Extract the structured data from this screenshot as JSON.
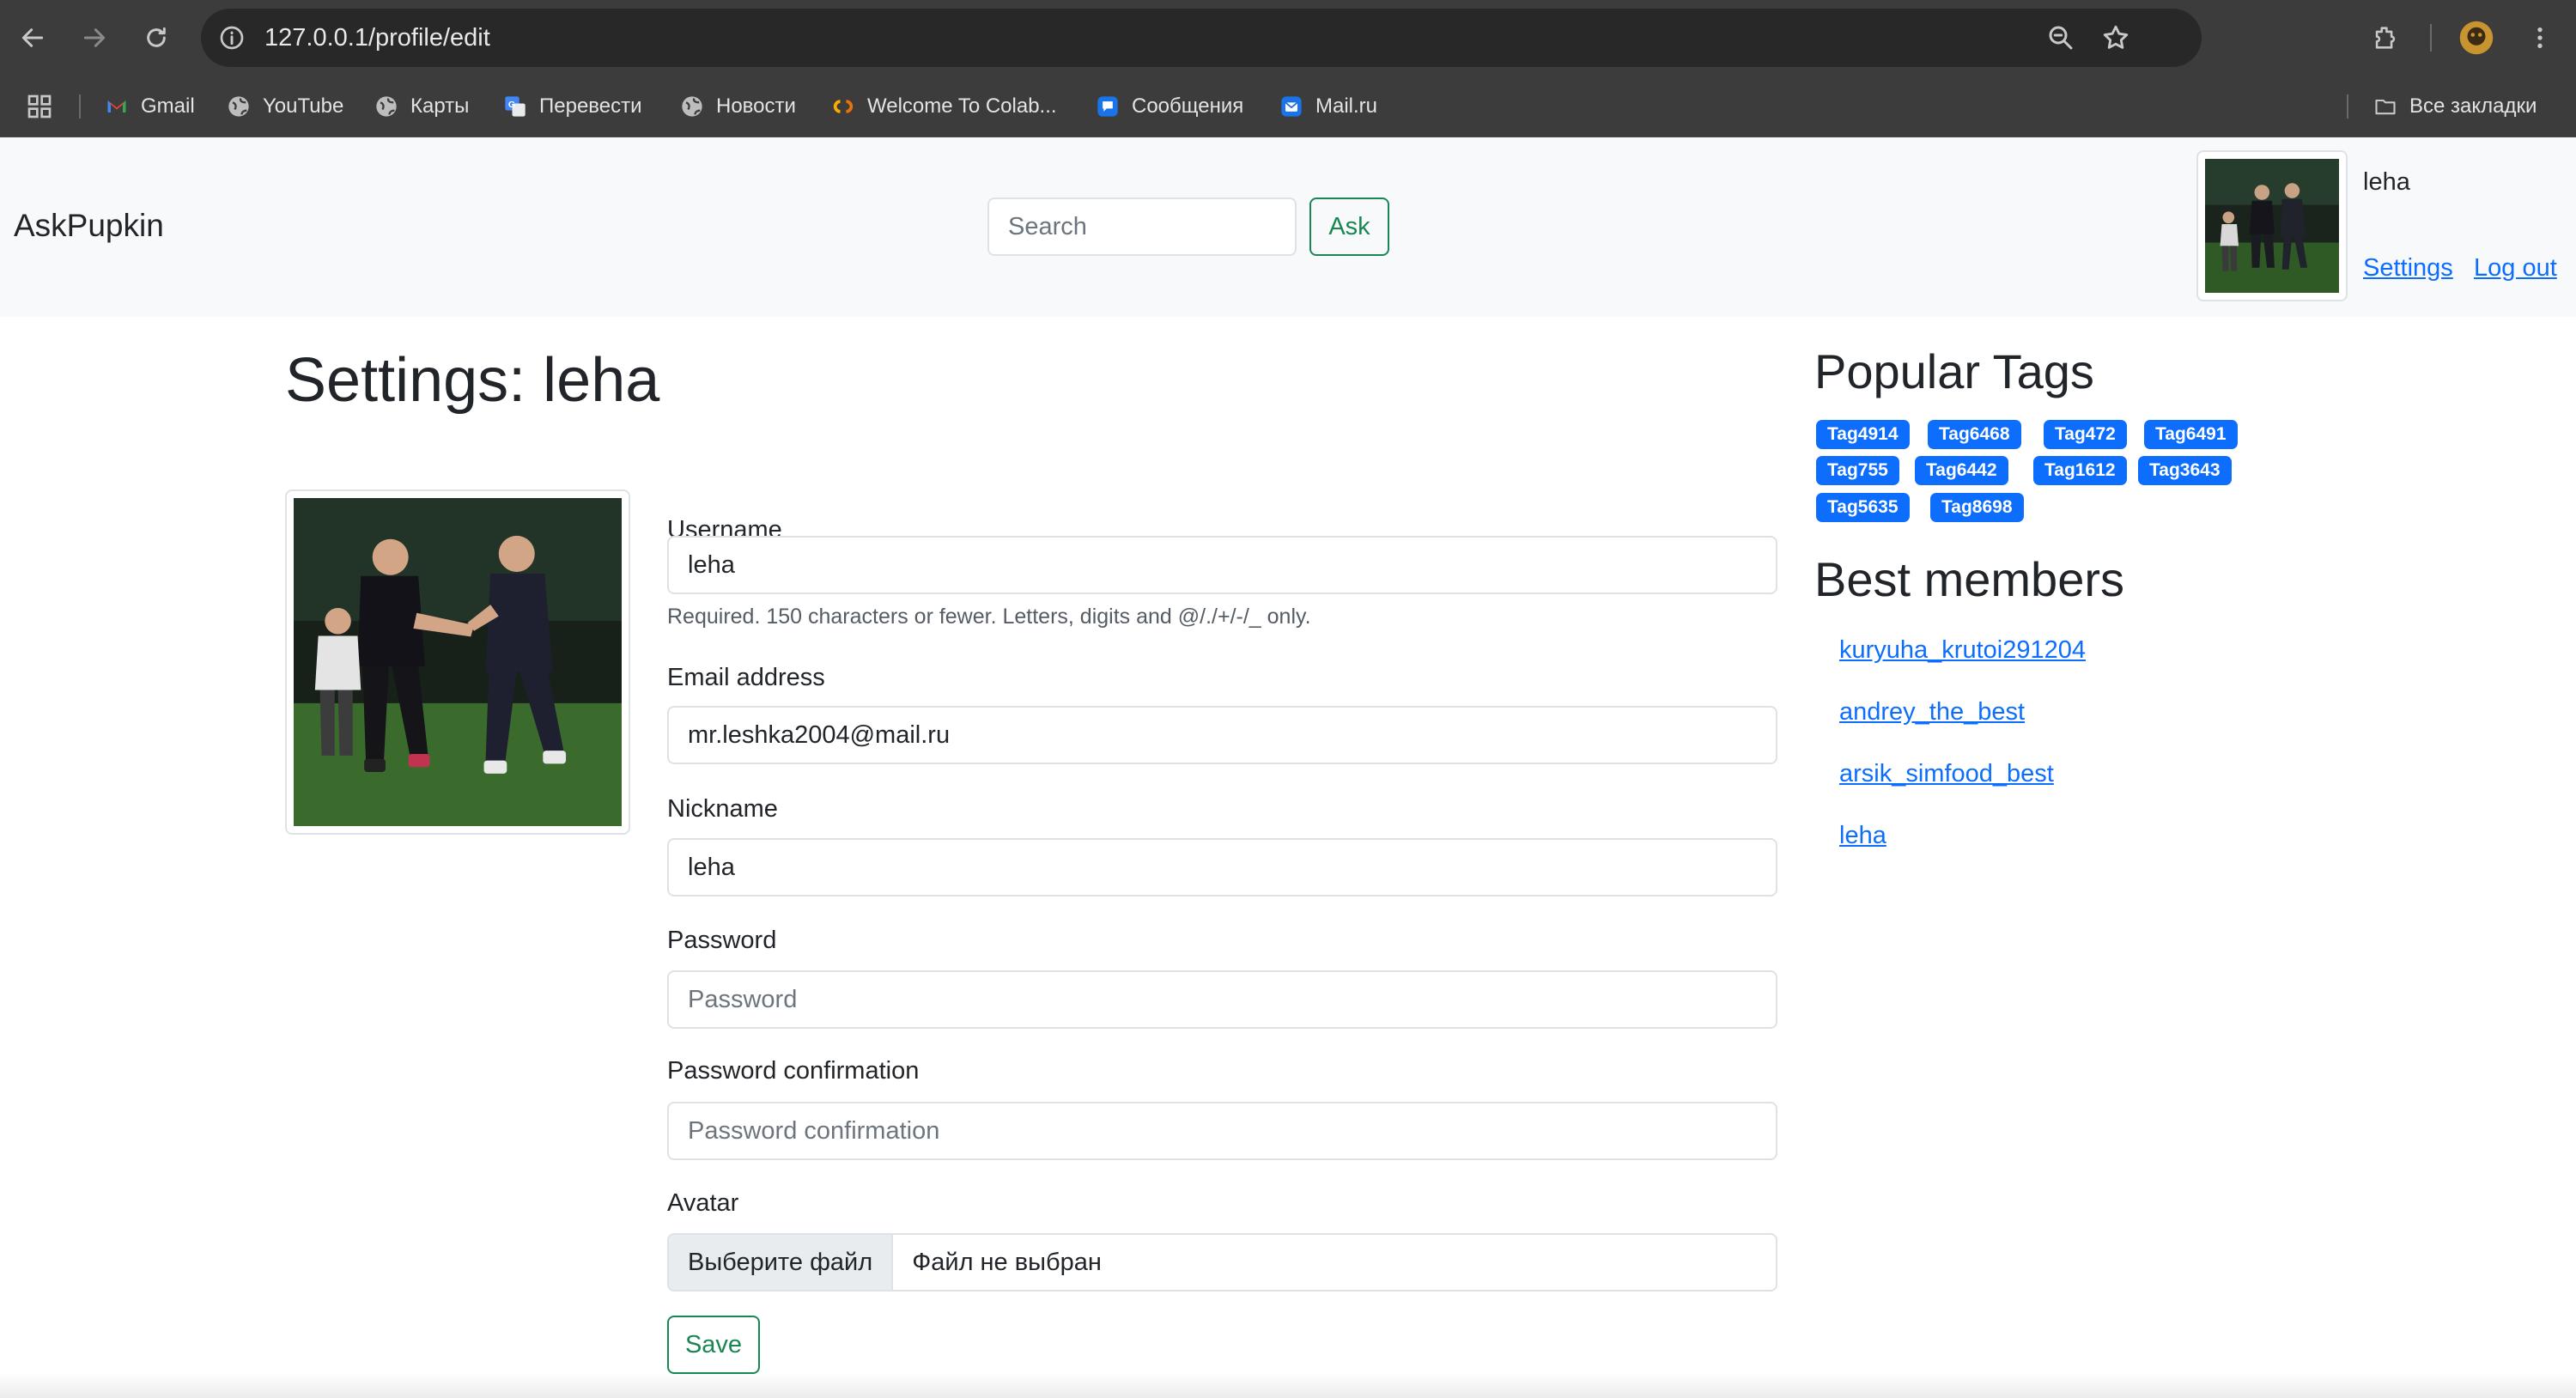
{
  "browser": {
    "url": "127.0.0.1/profile/edit",
    "bookmarks": [
      "Gmail",
      "YouTube",
      "Карты",
      "Перевести",
      "Новости",
      "Welcome To Colab...",
      "Сообщения",
      "Mail.ru"
    ],
    "all_bookmarks": "Все закладки"
  },
  "navbar": {
    "brand": "AskPupkin",
    "search_placeholder": "Search",
    "ask_label": "Ask",
    "username": "leha",
    "settings_link": "Settings",
    "logout_link": "Log out"
  },
  "main": {
    "title": "Settings: leha",
    "form": {
      "username_label": "Username",
      "username_value": "leha",
      "username_help": "Required. 150 characters or fewer. Letters, digits and @/./+/-/_ only.",
      "email_label": "Email address",
      "email_value": "mr.leshka2004@mail.ru",
      "nickname_label": "Nickname",
      "nickname_value": "leha",
      "password_label": "Password",
      "password_placeholder": "Password",
      "password_confirm_label": "Password confirmation",
      "password_confirm_placeholder": "Password confirmation",
      "avatar_label": "Avatar",
      "file_choose": "Выберите файл",
      "file_none": "Файл не выбран",
      "save_label": "Save"
    }
  },
  "sidebar": {
    "popular_tags_title": "Popular Tags",
    "tags": [
      "Tag4914",
      "Tag6468",
      "Tag472",
      "Tag6491",
      "Tag755",
      "Tag6442",
      "Tag1612",
      "Tag3643",
      "Tag5635",
      "Tag8698"
    ],
    "best_members_title": "Best members",
    "members": [
      "kuryuha_krutoi291204",
      "andrey_the_best",
      "arsik_simfood_best",
      "leha"
    ]
  },
  "colors": {
    "primary": "#0d6efd",
    "success": "#198754",
    "navbar_bg": "#f8f9fa",
    "chrome_bg": "#3c3c3c"
  }
}
